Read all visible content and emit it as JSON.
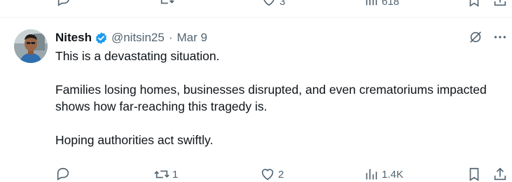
{
  "previous_tweet": {
    "reply_count": "",
    "like_count": "3",
    "view_count": "618"
  },
  "tweet": {
    "author_name": "Nitesh",
    "handle": "@nitsin25",
    "separator": "·",
    "date": "Mar 9",
    "paragraphs": [
      "This is a devastating situation.",
      "Families losing homes, businesses disrupted, and even crematoriums impacted shows how far-reaching this tragedy is.",
      "Hoping authorities act swiftly."
    ],
    "actions": {
      "replies": "",
      "reposts": "1",
      "likes": "2",
      "views": "1.4K"
    }
  },
  "icons": [
    "reply-icon",
    "repost-icon",
    "like-icon",
    "views-icon",
    "bookmark-icon",
    "share-icon",
    "grok-icon",
    "more-icon",
    "verified-icon"
  ],
  "colors": {
    "verified_blue": "#1d9bf0",
    "muted": "#536471",
    "text": "#0f1419"
  }
}
